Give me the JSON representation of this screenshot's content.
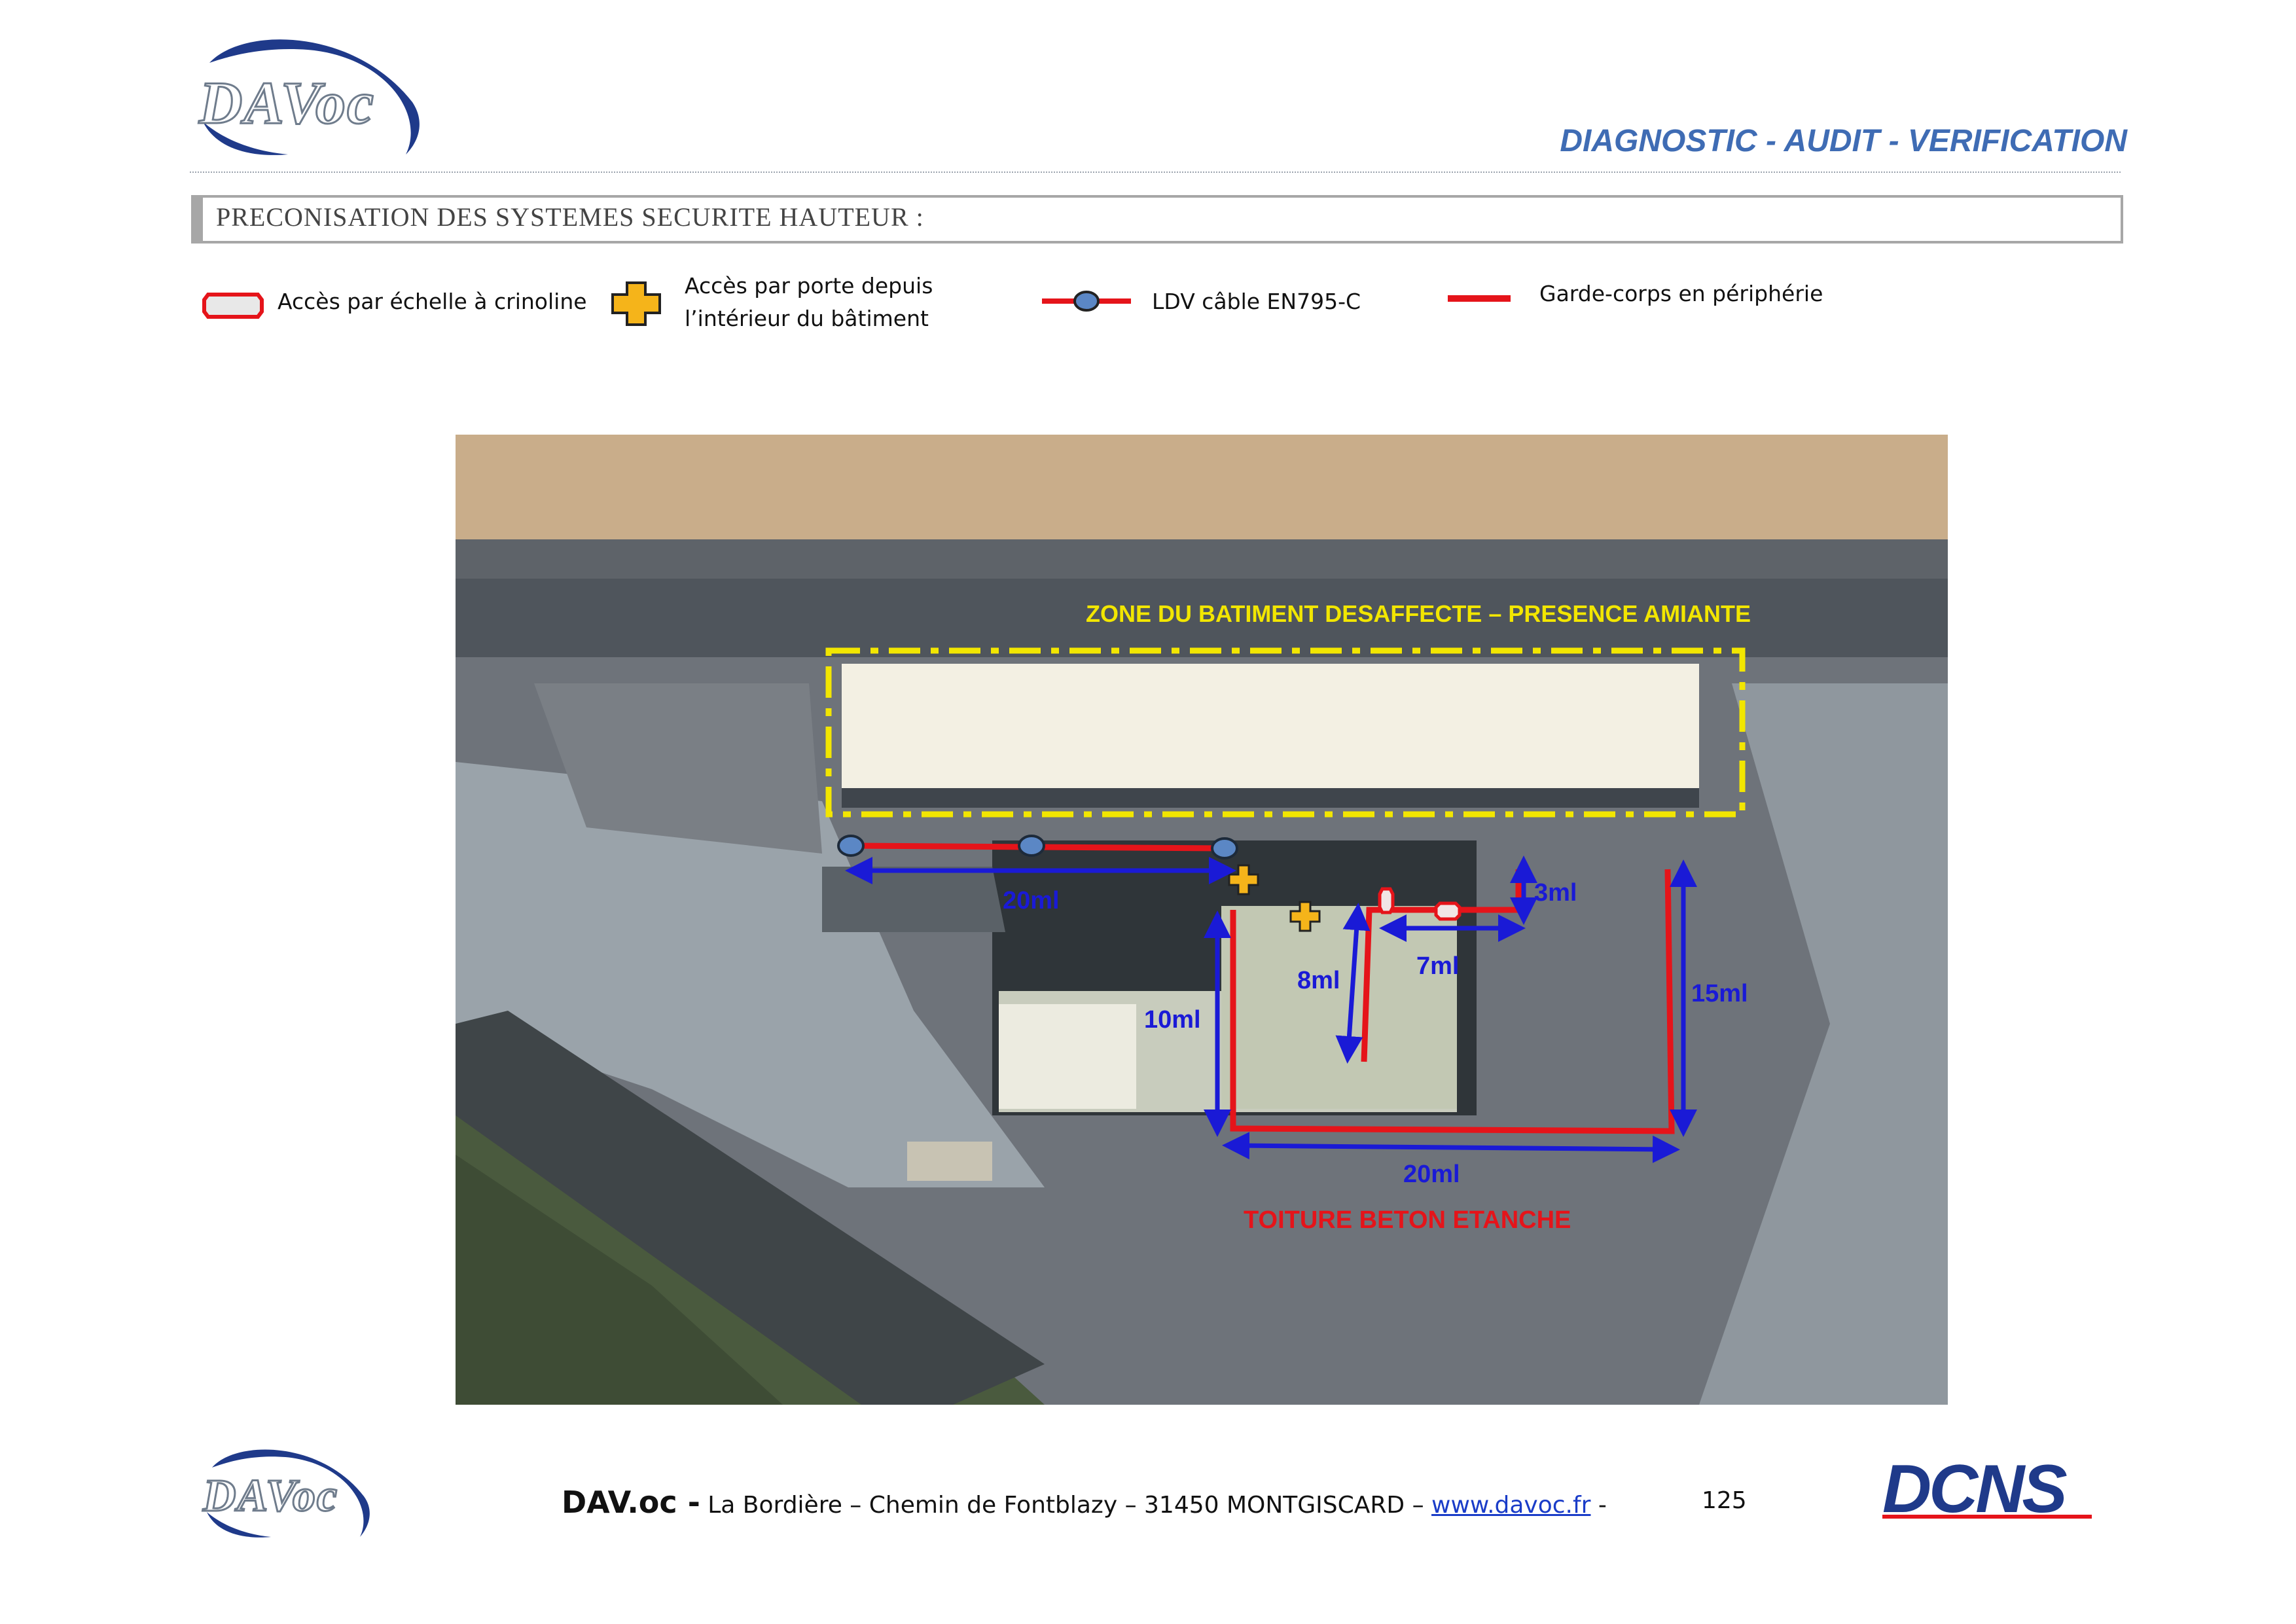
{
  "header": {
    "logo_text": "DAVoc",
    "title": "DIAGNOSTIC - AUDIT - VERIFICATION"
  },
  "section": {
    "heading": "PRECONISATION DES SYSTEMES SECURITE HAUTEUR :"
  },
  "legend": {
    "ladder": "Accès par échelle à crinoline",
    "door_line1": "Accès par porte depuis",
    "door_line2": "l’intérieur du bâtiment",
    "ldv": "LDV câble EN795-C",
    "guardrail": "Garde-corps en périphérie"
  },
  "map": {
    "zone_label": "ZONE DU BATIMENT DESAFFECTE – PRESENCE AMIANTE",
    "roof_label": "TOITURE BETON ETANCHE",
    "dimensions": {
      "d_20ml_top": "20ml",
      "d_3ml": "3ml",
      "d_7ml": "7ml",
      "d_8ml": "8ml",
      "d_10ml": "10ml",
      "d_15ml": "15ml",
      "d_20ml_bottom": "20ml"
    },
    "colors": {
      "zone_outline": "#f2e600",
      "guardrail": "#e5141a",
      "dimension_arrow": "#1a1ad6",
      "ldv_anchor": "#5b87c5",
      "door_access": "#f5b41a"
    }
  },
  "footer": {
    "logo_text": "DAVoc",
    "brand": "DAV.oc -",
    "address": "La Bordière – Chemin de Fontblazy – 31450 MONTGISCARD –",
    "link": "www.davoc.fr",
    "separator": "-",
    "page_number": "125",
    "client_logo": "DCNS"
  }
}
